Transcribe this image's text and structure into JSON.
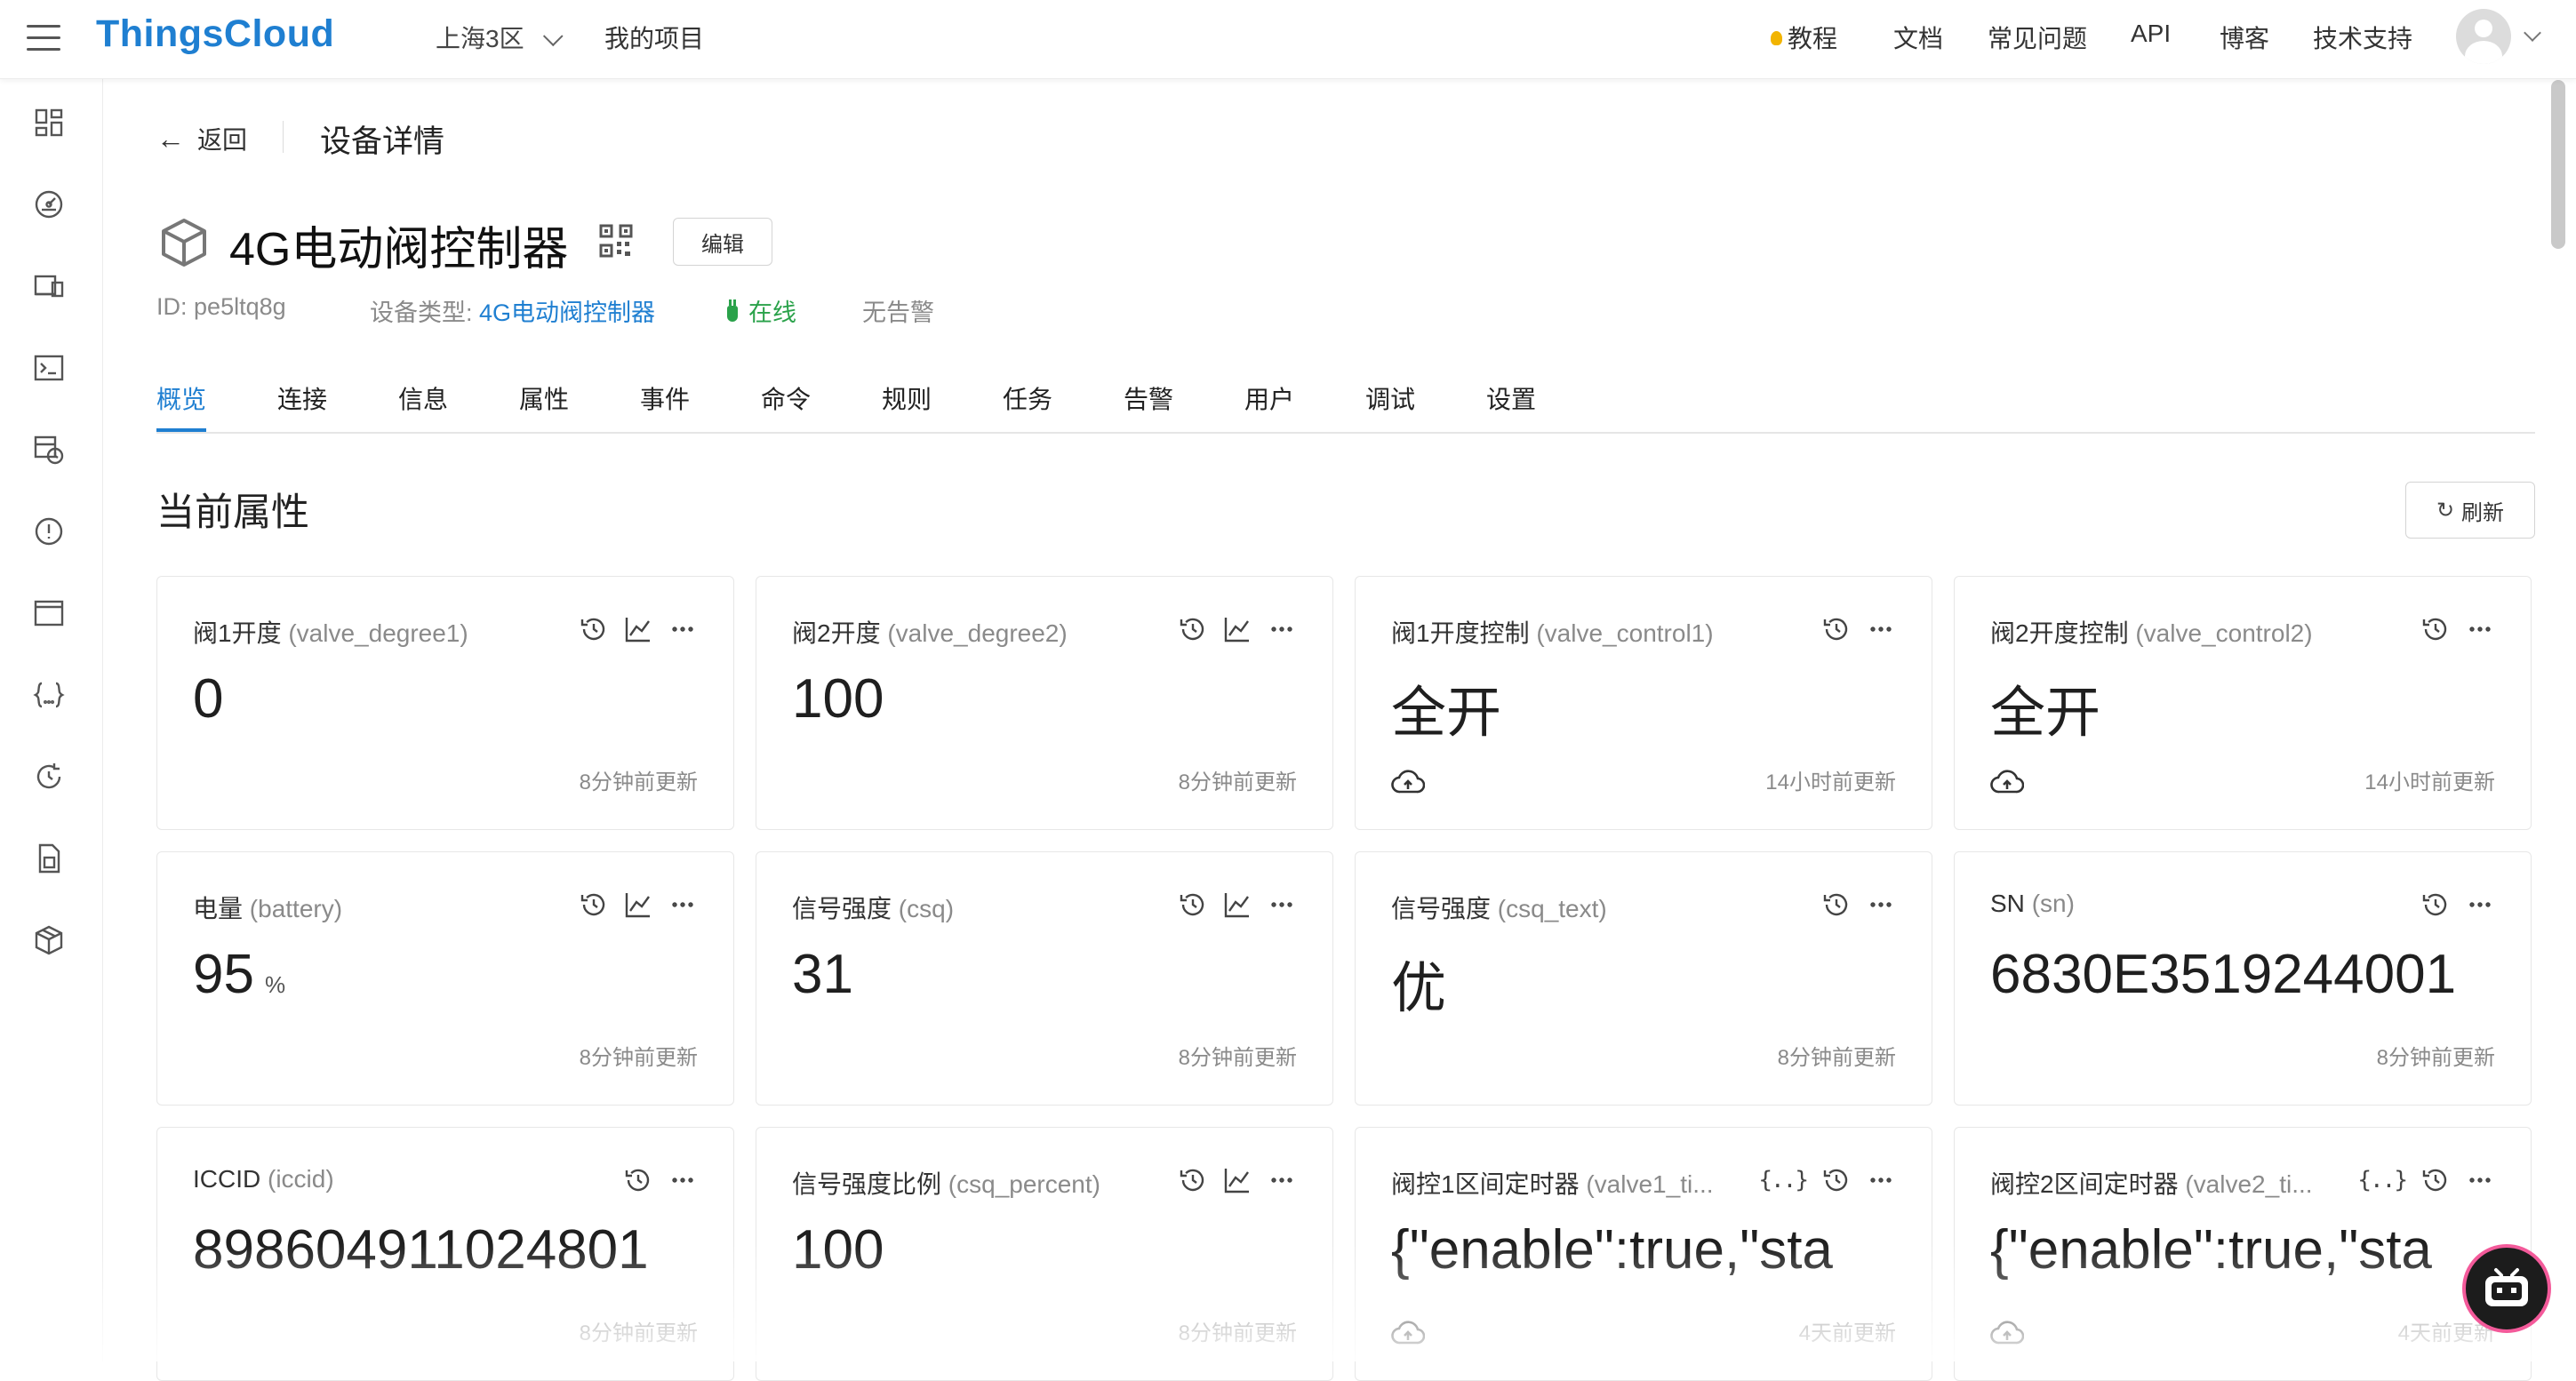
{
  "topbar": {
    "brand": "ThingsCloud",
    "region": "上海3区",
    "my_projects": "我的项目",
    "nav": {
      "tutorial": "教程",
      "docs": "文档",
      "faq": "常见问题",
      "api": "API",
      "blog": "博客",
      "support": "技术支持"
    }
  },
  "page": {
    "back_label": "返回",
    "title": "设备详情"
  },
  "device": {
    "name": "4G电动阀控制器",
    "edit_label": "编辑",
    "id_label": "ID:",
    "id": "pe5ltq8g",
    "type_label": "设备类型:",
    "type": "4G电动阀控制器",
    "status": "在线",
    "alarm": "无告警"
  },
  "tabs": [
    "概览",
    "连接",
    "信息",
    "属性",
    "事件",
    "命令",
    "规则",
    "任务",
    "告警",
    "用户",
    "调试",
    "设置"
  ],
  "section": {
    "title": "当前属性",
    "refresh_label": "刷新"
  },
  "cards": [
    {
      "label": "阀1开度",
      "key": "(valve_degree1)",
      "value": "0",
      "unit": "",
      "updated": "8分钟前更新"
    },
    {
      "label": "阀2开度",
      "key": "(valve_degree2)",
      "value": "100",
      "unit": "",
      "updated": "8分钟前更新"
    },
    {
      "label": "阀1开度控制",
      "key": "(valve_control1)",
      "value": "全开",
      "unit": "",
      "updated": "14小时前更新"
    },
    {
      "label": "阀2开度控制",
      "key": "(valve_control2)",
      "value": "全开",
      "unit": "",
      "updated": "14小时前更新"
    },
    {
      "label": "电量",
      "key": "(battery)",
      "value": "95",
      "unit": "%",
      "updated": "8分钟前更新"
    },
    {
      "label": "信号强度",
      "key": "(csq)",
      "value": "31",
      "unit": "",
      "updated": "8分钟前更新"
    },
    {
      "label": "信号强度",
      "key": "(csq_text)",
      "value": "优",
      "unit": "",
      "updated": "8分钟前更新"
    },
    {
      "label": "SN",
      "key": "(sn)",
      "value": "6830E3519244001",
      "unit": "",
      "updated": "8分钟前更新"
    },
    {
      "label": "ICCID",
      "key": "(iccid)",
      "value": "898604911024801",
      "unit": "",
      "updated": "8分钟前更新"
    },
    {
      "label": "信号强度比例",
      "key": "(csq_percent)",
      "value": "100",
      "unit": "",
      "updated": "8分钟前更新"
    },
    {
      "label": "阀控1区间定时器",
      "key": "(valve1_ti...",
      "value": "{\"enable\":true,\"sta",
      "unit": "",
      "updated": "4天前更新"
    },
    {
      "label": "阀控2区间定时器",
      "key": "(valve2_ti...",
      "value": "{\"enable\":true,\"sta",
      "unit": "",
      "updated": "4天前更新"
    }
  ]
}
